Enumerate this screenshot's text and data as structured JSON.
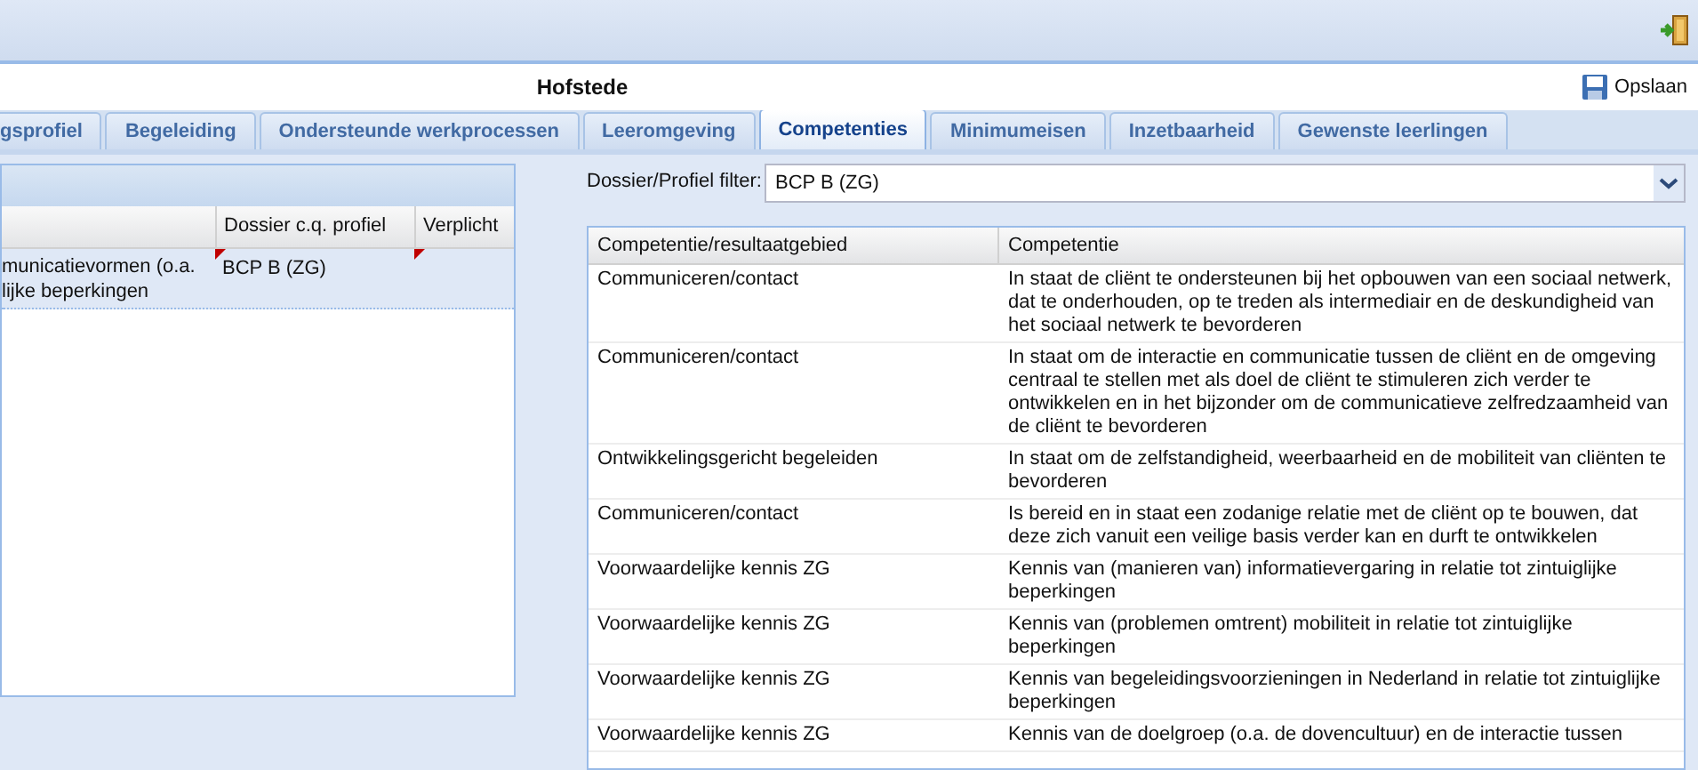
{
  "window": {
    "title": "Hofstede"
  },
  "toolbar": {
    "save_button": "Opslaan"
  },
  "tabs": [
    {
      "label": "gsprofiel",
      "selected": false
    },
    {
      "label": "Begeleiding",
      "selected": false
    },
    {
      "label": "Ondersteunde werkprocessen",
      "selected": false
    },
    {
      "label": "Leeromgeving",
      "selected": false
    },
    {
      "label": "Competenties",
      "selected": true
    },
    {
      "label": "Minimumeisen",
      "selected": false
    },
    {
      "label": "Inzetbaarheid",
      "selected": false
    },
    {
      "label": "Gewenste leerlingen",
      "selected": false
    }
  ],
  "left_grid": {
    "columns": [
      "Dossier c.q. profiel",
      "Verplicht"
    ],
    "rows": [
      {
        "selected": true,
        "column_1": [
          "municatievormen (o.a.",
          "lijke beperkingen"
        ],
        "profile": "BCP B (ZG)",
        "profile_dirty": true,
        "required_dirty": true
      }
    ]
  },
  "filter": {
    "label": "Dossier/Profiel filter:",
    "value": "BCP B (ZG)"
  },
  "table": {
    "columns": [
      "Competentie/resultaatgebied",
      "Competentie"
    ],
    "rows": [
      {
        "area": "Communiceren/contact",
        "competence": "In staat de cliënt te ondersteunen bij het opbouwen van een sociaal netwerk, dat te onderhouden, op te treden als intermediair en de deskundigheid van het sociaal netwerk te bevorderen"
      },
      {
        "area": "Communiceren/contact",
        "competence": "In staat om de interactie en communicatie tussen de cliënt en de omgeving centraal te stellen met als doel de cliënt te stimuleren zich verder te ontwikkelen en in het bijzonder om de communicatieve zelfredzaamheid van de cliënt te bevorderen"
      },
      {
        "area": "Ontwikkelingsgericht begeleiden",
        "competence": "In staat om de zelfstandigheid, weerbaarheid en de mobiliteit van cliënten te bevorderen"
      },
      {
        "area": "Communiceren/contact",
        "competence": "Is bereid en in staat een zodanige relatie met de cliënt op te bouwen, dat deze zich vanuit een veilige basis verder kan en durft te ontwikkelen"
      },
      {
        "area": "Voorwaardelijke kennis ZG",
        "competence": "Kennis van (manieren van) informatievergaring in relatie tot zintuiglijke beperkingen"
      },
      {
        "area": "Voorwaardelijke kennis ZG",
        "competence": "Kennis van (problemen omtrent) mobiliteit in relatie tot zintuiglijke beperkingen"
      },
      {
        "area": "Voorwaardelijke kennis ZG",
        "competence": "Kennis van begeleidingsvoorzieningen in Nederland in relatie tot zintuiglijke beperkingen"
      },
      {
        "area": "Voorwaardelijke kennis ZG",
        "competence": "Kennis van de doelgroep (o.a. de dovencultuur) en de interactie tussen"
      }
    ]
  }
}
